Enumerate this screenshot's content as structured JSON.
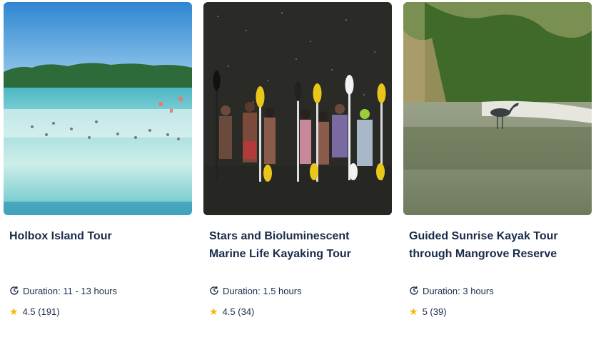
{
  "cards": [
    {
      "title": "Holbox Island Tour",
      "image": "beach-flamingos-photo",
      "duration": "Duration: 11 - 13 hours",
      "rating": "4.5",
      "reviews": "(191)"
    },
    {
      "title": "Stars and Bioluminescent Marine Life Kayaking Tour",
      "image": "night-kayakers-photo",
      "duration": "Duration: 1.5 hours",
      "rating": "4.5",
      "reviews": "(34)"
    },
    {
      "title": "Guided Sunrise Kayak Tour through Mangrove Reserve",
      "image": "mangrove-heron-photo",
      "duration": "Duration: 3 hours",
      "rating": "5",
      "reviews": "(39)"
    }
  ],
  "icons": {
    "duration": "clock-duration-icon",
    "rating": "star-icon"
  },
  "colors": {
    "text": "#1a2b49",
    "star": "#f7b500"
  }
}
